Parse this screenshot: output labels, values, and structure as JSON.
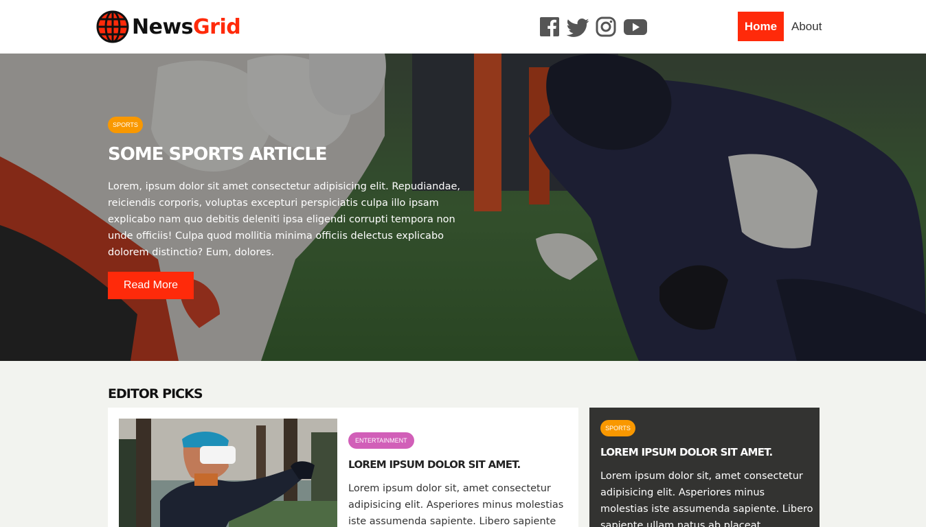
{
  "header": {
    "logo": {
      "part1": "News",
      "part2": "Grid",
      "icon": "globe-icon"
    },
    "social": [
      {
        "name": "facebook-icon"
      },
      {
        "name": "twitter-icon"
      },
      {
        "name": "instagram-icon"
      },
      {
        "name": "youtube-icon"
      }
    ],
    "nav": {
      "home": "Home",
      "about": "About"
    }
  },
  "hero": {
    "tag": "Sports",
    "title": "Some Sports Article",
    "text": "Lorem, ipsum dolor sit amet consectetur adipisicing elit. Repudiandae, reiciendis corporis, voluptas excepturi perspiciatis culpa illo ipsam explicabo nam quo debitis deleniti ipsa eligendi corrupti tempora non unde officiis! Culpa quod mollitia minima officiis delectus explicabo dolorem distinctio? Eum, dolores.",
    "button": "Read More"
  },
  "editor_picks": {
    "title": "Editor Picks",
    "cards": [
      {
        "tag": "Entertainment",
        "title": "Lorem ipsum dolor sit amet.",
        "text": "Lorem ipsum dolor sit, amet consectetur adipisicing elit. Asperiores minus molestias iste assumenda sapiente. Libero sapiente"
      },
      {
        "tag": "Sports",
        "title": "Lorem ipsum dolor sit amet.",
        "text": "Lorem ipsum dolor sit, amet consectetur adipisicing elit. Asperiores minus molestias iste assumenda sapiente. Libero sapiente ullam natus ab placeat"
      }
    ]
  },
  "colors": {
    "accent": "#ff2a0a",
    "sports_tag": "#f99800",
    "entertainment_tag": "#d15fb8",
    "dark_card": "#333331",
    "page_bg": "#f2f3ef"
  }
}
